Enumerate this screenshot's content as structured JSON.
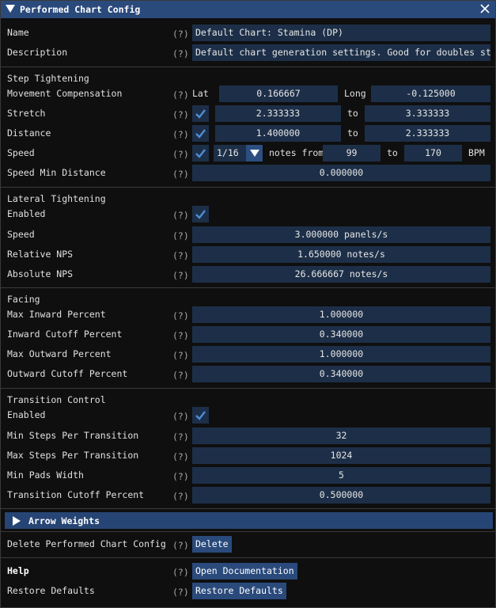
{
  "window": {
    "title": "Performed Chart Config"
  },
  "help_marker": "(?)",
  "general": {
    "name_label": "Name",
    "name_value": "Default Chart: Stamina (DP)",
    "description_label": "Description",
    "description_value": "Default chart generation settings. Good for doubles stamina."
  },
  "step_tightening": {
    "header": "Step Tightening",
    "movement_label": "Movement Compensation",
    "lat_label": "Lat",
    "lat_value": "0.166667",
    "long_label": "Long",
    "long_value": "-0.125000",
    "stretch_label": "Stretch",
    "stretch_checked": true,
    "stretch_min": "2.333333",
    "to_label": "to",
    "stretch_max": "3.333333",
    "distance_label": "Distance",
    "distance_checked": true,
    "distance_min": "1.400000",
    "distance_max": "2.333333",
    "speed_label": "Speed",
    "speed_checked": true,
    "speed_subdivision": "1/16",
    "notes_from_label": "notes from",
    "speed_min": "99",
    "speed_max": "170",
    "bpm_label": "BPM",
    "speed_min_distance_label": "Speed Min Distance",
    "speed_min_distance_value": "0.000000"
  },
  "lateral_tightening": {
    "header": "Lateral Tightening",
    "enabled_label": "Enabled",
    "enabled_checked": true,
    "speed_label": "Speed",
    "speed_value": "3.000000 panels/s",
    "relative_nps_label": "Relative NPS",
    "relative_nps_value": "1.650000 notes/s",
    "absolute_nps_label": "Absolute NPS",
    "absolute_nps_value": "26.666667 notes/s"
  },
  "facing": {
    "header": "Facing",
    "max_inward_label": "Max Inward Percent",
    "max_inward_value": "1.000000",
    "inward_cutoff_label": "Inward Cutoff Percent",
    "inward_cutoff_value": "0.340000",
    "max_outward_label": "Max Outward Percent",
    "max_outward_value": "1.000000",
    "outward_cutoff_label": "Outward Cutoff Percent",
    "outward_cutoff_value": "0.340000"
  },
  "transition_control": {
    "header": "Transition Control",
    "enabled_label": "Enabled",
    "enabled_checked": true,
    "min_steps_label": "Min Steps Per Transition",
    "min_steps_value": "32",
    "max_steps_label": "Max Steps Per Transition",
    "max_steps_value": "1024",
    "min_pads_label": "Min Pads Width",
    "min_pads_value": "5",
    "cutoff_label": "Transition Cutoff Percent",
    "cutoff_value": "0.500000"
  },
  "arrow_weights": {
    "label": "Arrow Weights"
  },
  "delete": {
    "label": "Delete Performed Chart Config",
    "button": "Delete"
  },
  "help": {
    "label": "Help",
    "button": "Open Documentation"
  },
  "restore": {
    "label": "Restore Defaults",
    "button": "Restore Defaults"
  },
  "colors": {
    "title_bar": "#2a4a7c",
    "field_bg": "#1d2f48",
    "check": "#4d8ed6",
    "button": "#2a4a7c"
  }
}
